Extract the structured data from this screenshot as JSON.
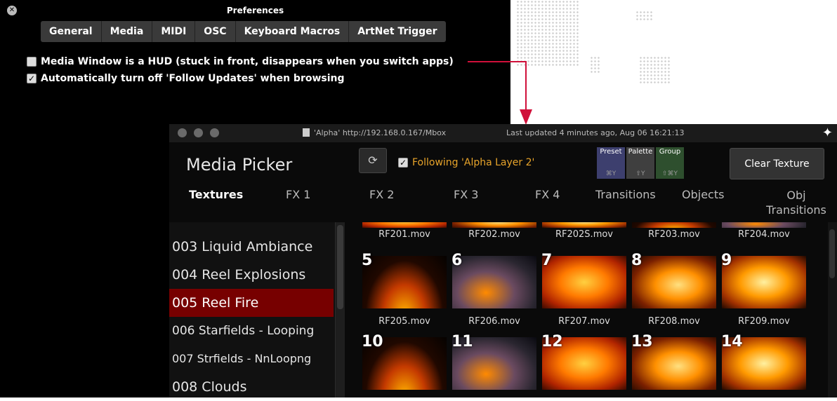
{
  "preferences": {
    "title": "Preferences",
    "tabs": [
      "General",
      "Media",
      "MIDI",
      "OSC",
      "Keyboard Macros",
      "ArtNet Trigger"
    ],
    "options": [
      {
        "label": "Media Window is a HUD (stuck in front, disappears when you switch apps)",
        "checked": false
      },
      {
        "label": "Automatically turn off 'Follow Updates' when browsing",
        "checked": true
      }
    ]
  },
  "media_picker": {
    "source": "'Alpha' http://192.168.0.167/Mbox",
    "last_updated": "Last updated 4 minutes ago, Aug 06 16:21:13",
    "title": "Media Picker",
    "following": "Following 'Alpha Layer 2'",
    "buttons": {
      "preset": {
        "label": "Preset",
        "shortcut": "⌘Y",
        "color": "#3d3f6e"
      },
      "palette": {
        "label": "Palette",
        "shortcut": "⇧Y",
        "color": "#3f3f3f"
      },
      "group": {
        "label": "Group",
        "shortcut": "⇧⌘Y",
        "color": "#2e4f2e"
      },
      "clear": "Clear Texture"
    },
    "tabs": [
      "Textures",
      "FX 1",
      "FX 2",
      "FX 3",
      "FX 4",
      "Transitions",
      "Objects",
      "Obj Transitions"
    ],
    "folders": [
      "003 Liquid Ambiance",
      "004 Reel Explosions",
      "005 Reel Fire",
      "006 Starfields - Looping",
      "007 Strfields - NnLoopng",
      "008 Clouds"
    ],
    "selected_folder": "005 Reel Fire",
    "top_row_files": [
      "RF201.mov",
      "RF202.mov",
      "RF202S.mov",
      "RF203.mov",
      "RF204.mov"
    ],
    "files": [
      {
        "num": "5",
        "name": "RF205.mov"
      },
      {
        "num": "6",
        "name": "RF206.mov"
      },
      {
        "num": "7",
        "name": "RF207.mov"
      },
      {
        "num": "8",
        "name": "RF208.mov"
      },
      {
        "num": "9",
        "name": "RF209.mov"
      },
      {
        "num": "10",
        "name": ""
      },
      {
        "num": "11",
        "name": ""
      },
      {
        "num": "12",
        "name": ""
      },
      {
        "num": "13",
        "name": ""
      },
      {
        "num": "14",
        "name": ""
      }
    ]
  },
  "colors": {
    "accent_follow": "#e8a42a",
    "selection": "#770000",
    "annotation_arrow": "#d0103a"
  }
}
